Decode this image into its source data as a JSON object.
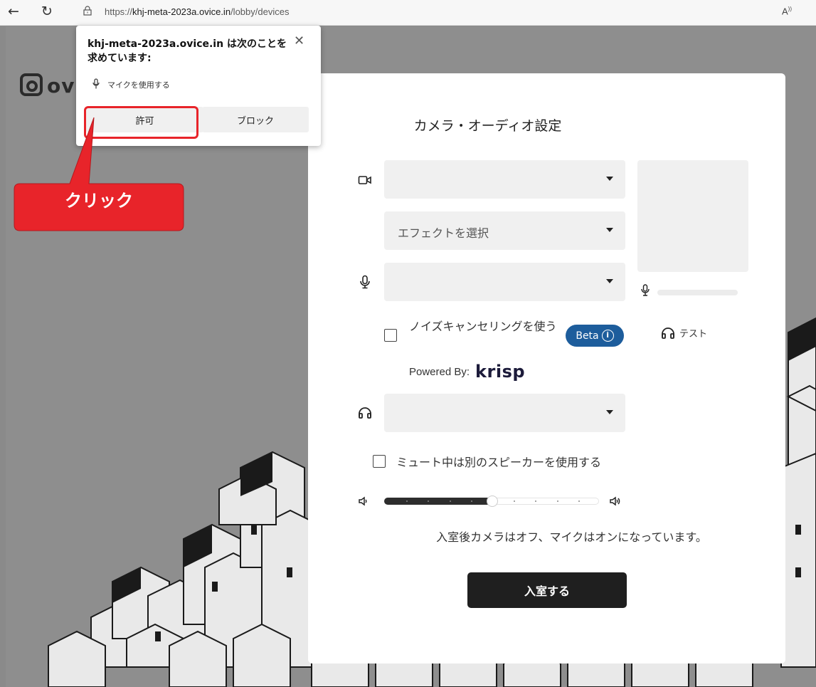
{
  "browser": {
    "url_prefix": "https://",
    "url_host": "khj-meta-2023a.ovice.in",
    "url_path": "/lobby/devices",
    "read_aloud": "A"
  },
  "logo": {
    "text": "ovi"
  },
  "permission_popup": {
    "title": "khj-meta-2023a.ovice.in は次のことを求めています:",
    "item": "マイクを使用する",
    "allow_label": "許可",
    "block_label": "ブロック"
  },
  "annotation": {
    "callout_text": "クリック",
    "color": "#e8242a"
  },
  "modal": {
    "title": "カメラ・オーディオ設定",
    "effect_placeholder": "エフェクトを選択",
    "test_label": "テスト",
    "noise_cancel_label": "ノイズキャンセリングを使う",
    "beta_label": "Beta",
    "powered_by": "Powered By:",
    "krisp": "krisp",
    "mute_speaker_label": "ミュート中は別のスピーカーを使用する",
    "volume_fraction": 0.5,
    "info_text": "入室後カメラはオフ、マイクはオンになっています。",
    "enter_label": "入室する"
  }
}
